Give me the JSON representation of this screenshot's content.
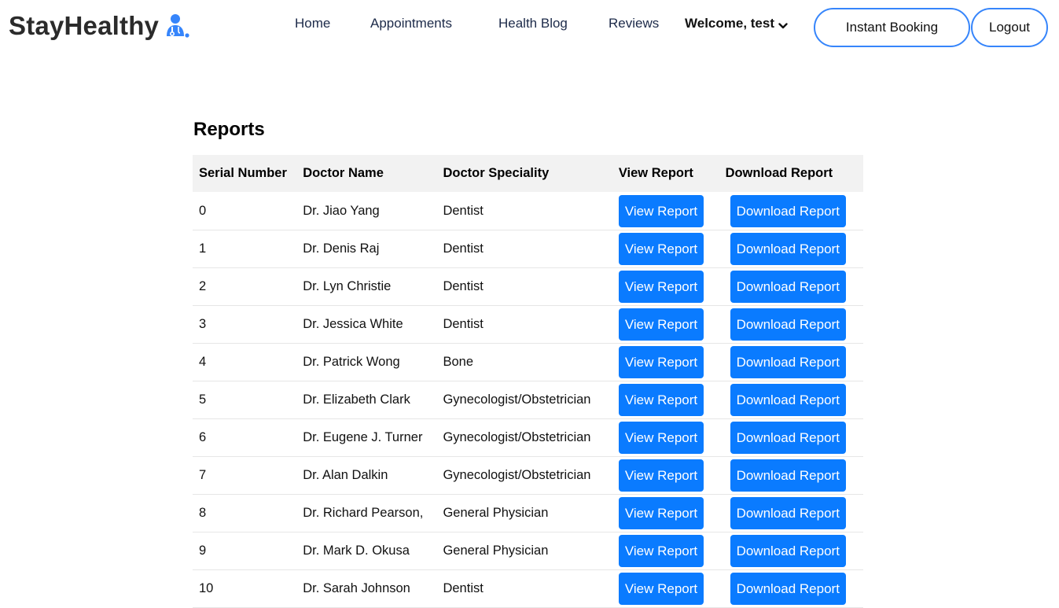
{
  "header": {
    "logo_text": "StayHealthy",
    "nav": [
      {
        "label": "Home"
      },
      {
        "label": "Appointments"
      },
      {
        "label": "Health Blog"
      },
      {
        "label": "Reviews"
      }
    ],
    "welcome": "Welcome, test",
    "instant_booking": "Instant Booking",
    "logout": "Logout",
    "accent_color": "#3685fb"
  },
  "reports": {
    "title": "Reports",
    "columns": [
      "Serial Number",
      "Doctor Name",
      "Doctor Speciality",
      "View Report",
      "Download Report"
    ],
    "view_label": "View Report",
    "download_label": "Download Report",
    "button_color": "#0a7bff",
    "rows": [
      {
        "serial": "0",
        "name": "Dr. Jiao Yang",
        "speciality": "Dentist"
      },
      {
        "serial": "1",
        "name": "Dr. Denis Raj",
        "speciality": "Dentist"
      },
      {
        "serial": "2",
        "name": "Dr. Lyn Christie",
        "speciality": "Dentist"
      },
      {
        "serial": "3",
        "name": "Dr. Jessica White",
        "speciality": "Dentist"
      },
      {
        "serial": "4",
        "name": "Dr. Patrick Wong",
        "speciality": "Bone"
      },
      {
        "serial": "5",
        "name": "Dr. Elizabeth Clark",
        "speciality": "Gynecologist/Obstetrician"
      },
      {
        "serial": "6",
        "name": "Dr. Eugene J. Turner",
        "speciality": "Gynecologist/Obstetrician"
      },
      {
        "serial": "7",
        "name": "Dr. Alan Dalkin",
        "speciality": "Gynecologist/Obstetrician"
      },
      {
        "serial": "8",
        "name": "Dr. Richard Pearson,",
        "speciality": "General Physician"
      },
      {
        "serial": "9",
        "name": "Dr. Mark D. Okusa",
        "speciality": "General Physician"
      },
      {
        "serial": "10",
        "name": "Dr. Sarah Johnson",
        "speciality": "Dentist"
      }
    ]
  }
}
